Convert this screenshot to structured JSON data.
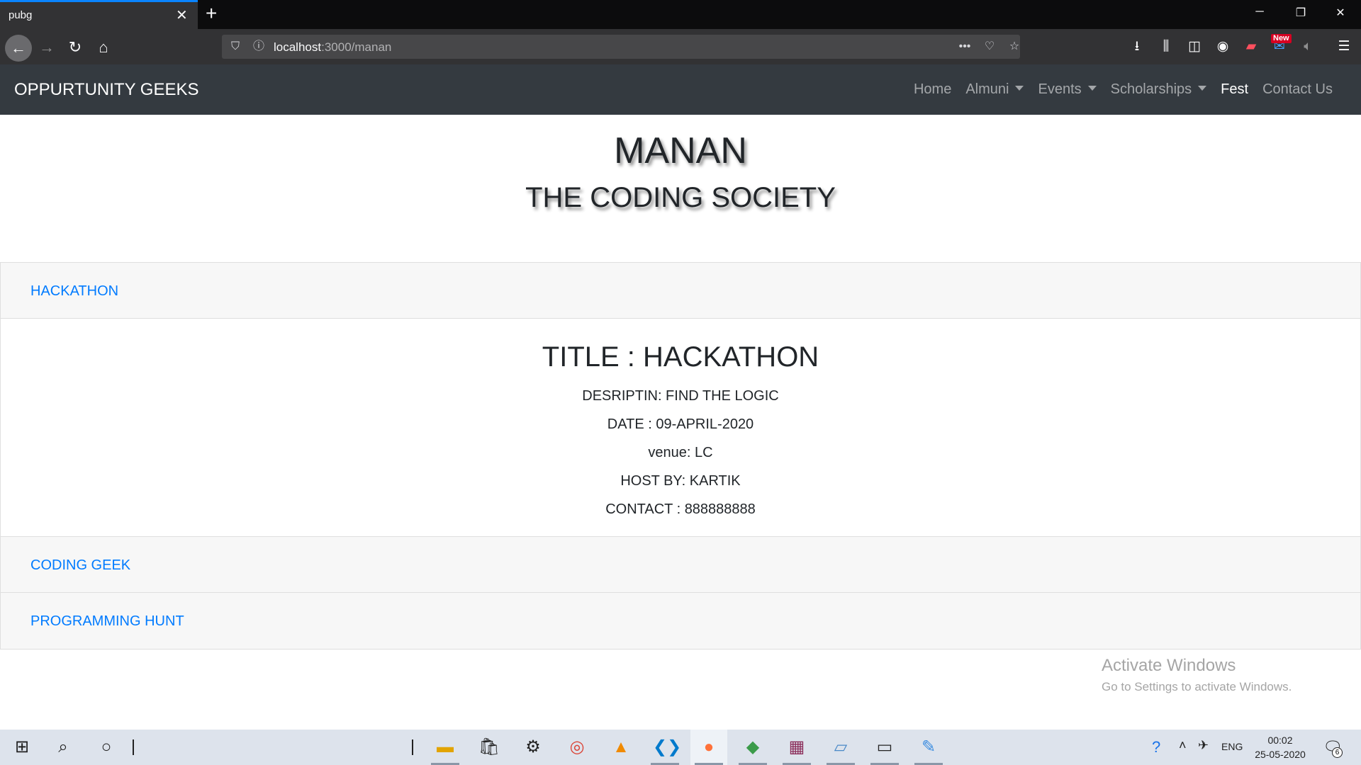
{
  "browser": {
    "tab_title": "pubg",
    "tab_close": "✕",
    "new_tab": "+",
    "url_host": "localhost",
    "url_path": ":3000/manan",
    "new_badge": "New",
    "window_controls": [
      "─",
      "❐",
      "✕"
    ]
  },
  "site": {
    "brand": "OPPURTUNITY GEEKS",
    "nav": [
      {
        "label": "Home",
        "dropdown": false,
        "active": false
      },
      {
        "label": "Almuni",
        "dropdown": true,
        "active": false
      },
      {
        "label": "Events",
        "dropdown": true,
        "active": false
      },
      {
        "label": "Scholarships",
        "dropdown": true,
        "active": false
      },
      {
        "label": "Fest",
        "dropdown": false,
        "active": true
      },
      {
        "label": "Contact Us",
        "dropdown": false,
        "active": false
      }
    ]
  },
  "header": {
    "title": "MANAN",
    "subtitle": "THE CODING SOCIETY"
  },
  "accordion": {
    "items": [
      {
        "label": "HACKATHON",
        "expanded": true
      },
      {
        "label": "CODING GEEK",
        "expanded": false
      },
      {
        "label": "PROGRAMMING HUNT",
        "expanded": false
      }
    ],
    "event": {
      "title": "TITLE : HACKATHON",
      "description": "DESRIPTIN: FIND THE LOGIC",
      "date": "DATE : 09-APRIL-2020",
      "venue": "venue: LC",
      "host": "HOST BY: KARTIK",
      "contact": "CONTACT : 888888888"
    }
  },
  "watermark": {
    "line1": "Activate Windows",
    "line2": "Go to Settings to activate Windows."
  },
  "taskbar": {
    "lang": "ENG",
    "time": "00:02",
    "date": "25-05-2020",
    "notifications": "6"
  },
  "colors": {
    "site_nav_bg": "#343a40",
    "link": "#007bff",
    "accordion_header_bg": "#f7f7f7",
    "browser_tab_accent": "#0a84ff"
  }
}
